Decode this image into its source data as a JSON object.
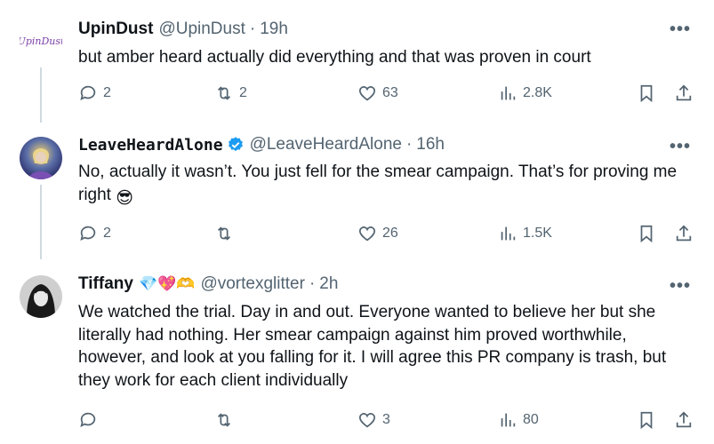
{
  "colors": {
    "text": "#0f1419",
    "muted": "#536471",
    "verified": "#1d9bf0",
    "thread_line": "#cfd9de"
  },
  "tweets": [
    {
      "name": "UpinDust",
      "handle": "@UpinDust",
      "time": "19h",
      "avatar_text": "UpinDust",
      "text": "but amber heard actually did everything and that was proven in court",
      "replies": "2",
      "retweets": "2",
      "likes": "63",
      "views": "2.8K"
    },
    {
      "name": "LeaveHeardAlone",
      "handle": "@LeaveHeardAlone",
      "time": "16h",
      "verified": true,
      "text": "No, actually it wasn’t. You just fell for the smear campaign. That’s for proving me right",
      "emoji": "😎",
      "replies": "2",
      "retweets": "",
      "likes": "26",
      "views": "1.5K"
    },
    {
      "name": "Tiffany",
      "name_emojis": [
        "💎",
        "💖",
        "🫶"
      ],
      "handle": "@vortexglitter",
      "time": "2h",
      "text": "We watched the trial. Day in and out. Everyone wanted to believe her but she literally had nothing. Her smear campaign against him proved worthwhile, however, and look at you falling for it.  I will agree this PR company is trash, but they work for each client individually",
      "replies": "",
      "retweets": "",
      "likes": "3",
      "views": "80"
    }
  ],
  "separator": "·",
  "more_label": "•••"
}
